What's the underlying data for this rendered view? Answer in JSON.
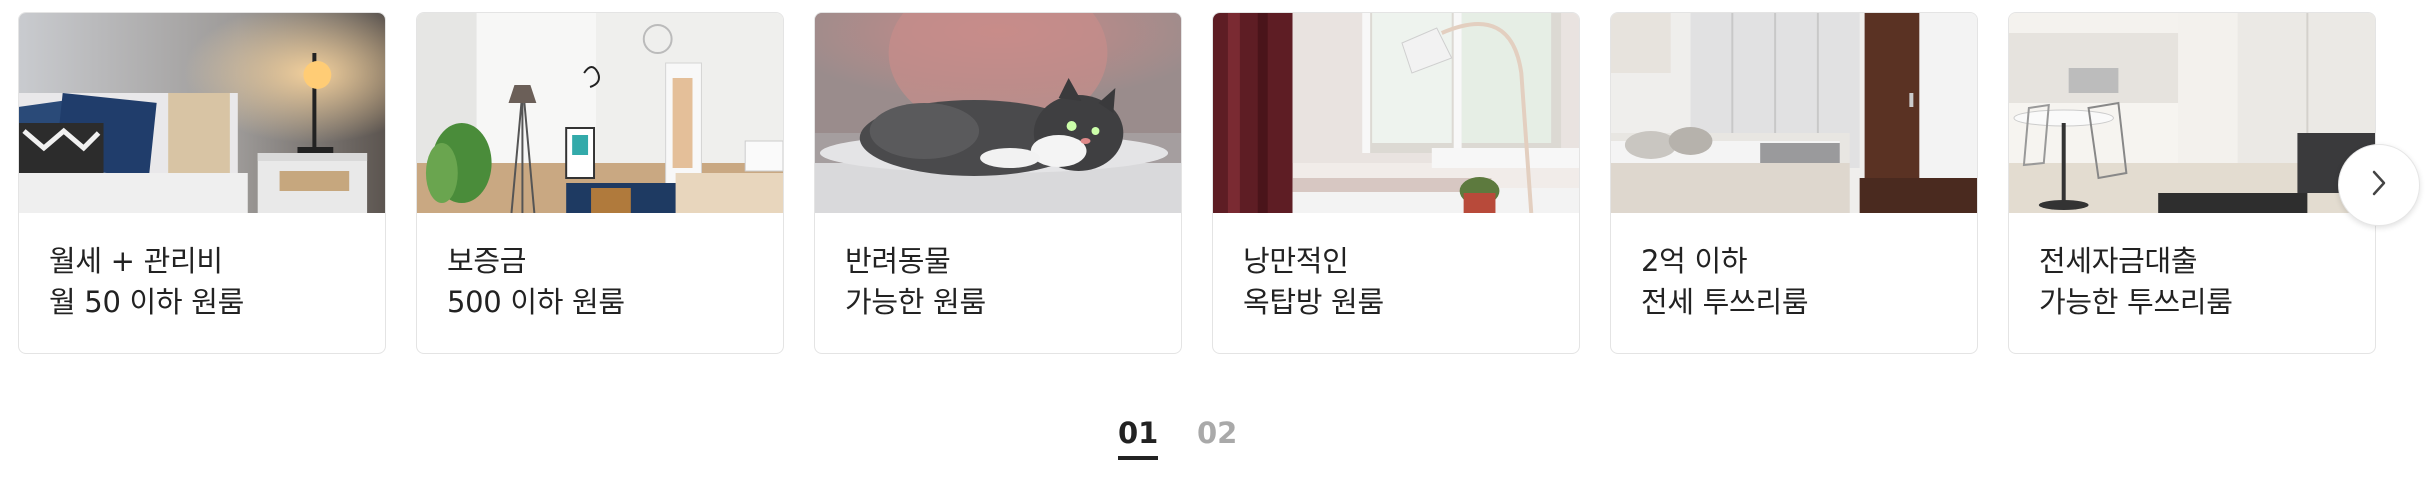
{
  "cards": [
    {
      "line1": "월세 + 관리비",
      "line2": "월 50 이하 원룸",
      "image": "bedroom-lamp-photo"
    },
    {
      "line1": "보증금",
      "line2": "500 이하 원룸",
      "image": "bright-room-photo"
    },
    {
      "line1": "반려동물",
      "line2": "가능한 원룸",
      "image": "cat-photo"
    },
    {
      "line1": "낭만적인",
      "line2": "옥탑방 원룸",
      "image": "window-lamp-photo"
    },
    {
      "line1": "2억 이하",
      "line2": "전세 투쓰리룸",
      "image": "bedroom-closet-photo"
    },
    {
      "line1": "전세자금대출",
      "line2": "가능한 투쓰리룸",
      "image": "kitchen-dining-photo"
    }
  ],
  "carousel": {
    "next_icon": "chevron-right-icon"
  },
  "pagination": {
    "pages": [
      "01",
      "02"
    ],
    "active": "01"
  }
}
